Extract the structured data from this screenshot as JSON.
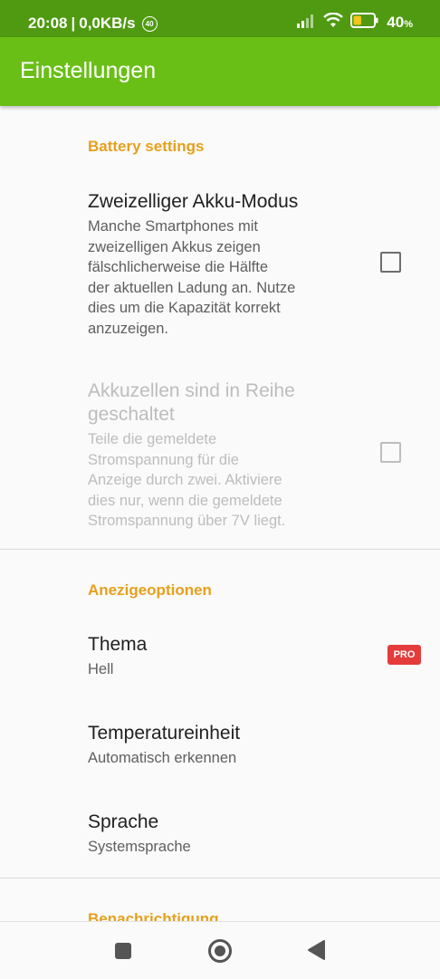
{
  "status_bar": {
    "time": "20:08",
    "separator": "|",
    "speed": "0,0KB/s",
    "badge": "40",
    "battery_pct": "40",
    "battery_pct_suffix": "%",
    "battery_level": 0.4,
    "icons": [
      "signal-icon",
      "wifi-icon",
      "battery-icon"
    ]
  },
  "app_bar": {
    "title": "Einstellungen"
  },
  "colors": {
    "status_bar": "#4f9a10",
    "app_bar": "#6abf17",
    "category": "#e6a01c",
    "pro_badge": "#e43b3b",
    "battery_fill": "#f5c518"
  },
  "sections": [
    {
      "category": "Battery settings",
      "items": [
        {
          "title": "Zweizelliger Akku-Modus",
          "summary_lines": [
            "Manche Smartphones mit",
            "zweizelligen Akkus zeigen",
            "fälschlicherweise die Hälfte",
            "der aktuellen Ladung an. Nutze",
            "dies um die Kapazität korrekt",
            "anzuzeigen."
          ],
          "checked": false,
          "enabled": true
        },
        {
          "title_lines": [
            "Akkuzellen sind in Reihe",
            "geschaltet"
          ],
          "summary_lines": [
            "Teile die gemeldete",
            "Stromspannung für die",
            "Anzeige durch zwei. Aktiviere",
            "dies nur, wenn die gemeldete",
            "Stromspannung über 7V liegt."
          ],
          "checked": false,
          "enabled": false
        }
      ]
    },
    {
      "category": "Anezigeoptionen",
      "items": [
        {
          "title": "Thema",
          "summary": "Hell",
          "badge": "PRO"
        },
        {
          "title": "Temperatureinheit",
          "summary": "Automatisch erkennen"
        },
        {
          "title": "Sprache",
          "summary": "Systemsprache"
        }
      ]
    },
    {
      "category": "Benachrichtigung"
    }
  ],
  "nav_bar": {
    "icons": [
      "recents-square-icon",
      "home-circle-icon",
      "back-triangle-icon"
    ]
  }
}
